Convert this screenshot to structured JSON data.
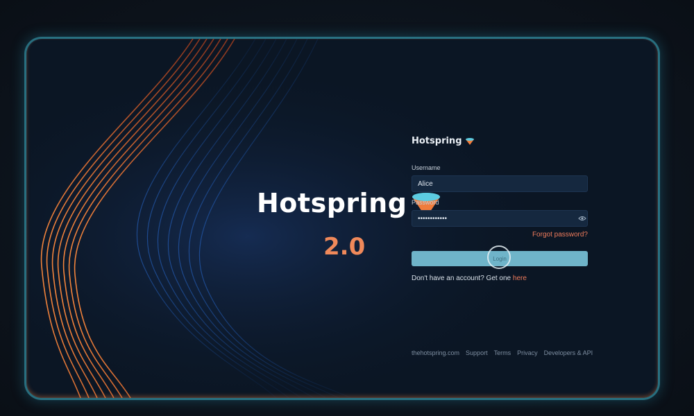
{
  "hero": {
    "brand": "Hotspring",
    "version": "2.0"
  },
  "login": {
    "brand": "Hotspring",
    "username_label": "Username",
    "username_value": "Alice",
    "password_label": "Password",
    "password_value": "••••••••••••",
    "forgot_password": "Forgot password?",
    "login_button": "Login",
    "signup_prompt": "Don't have an account? Get one",
    "signup_link": "here"
  },
  "footer": {
    "links": [
      "thehotspring.com",
      "Support",
      "Terms",
      "Privacy",
      "Developers & API"
    ]
  },
  "colors": {
    "accent": "#f07c5c",
    "button": "#6fb4c9",
    "funnel_top": "#4fc3d9",
    "funnel_bottom": "#f07c3c"
  },
  "icons": {
    "brand": "funnel-icon",
    "password_toggle": "eye-icon"
  }
}
